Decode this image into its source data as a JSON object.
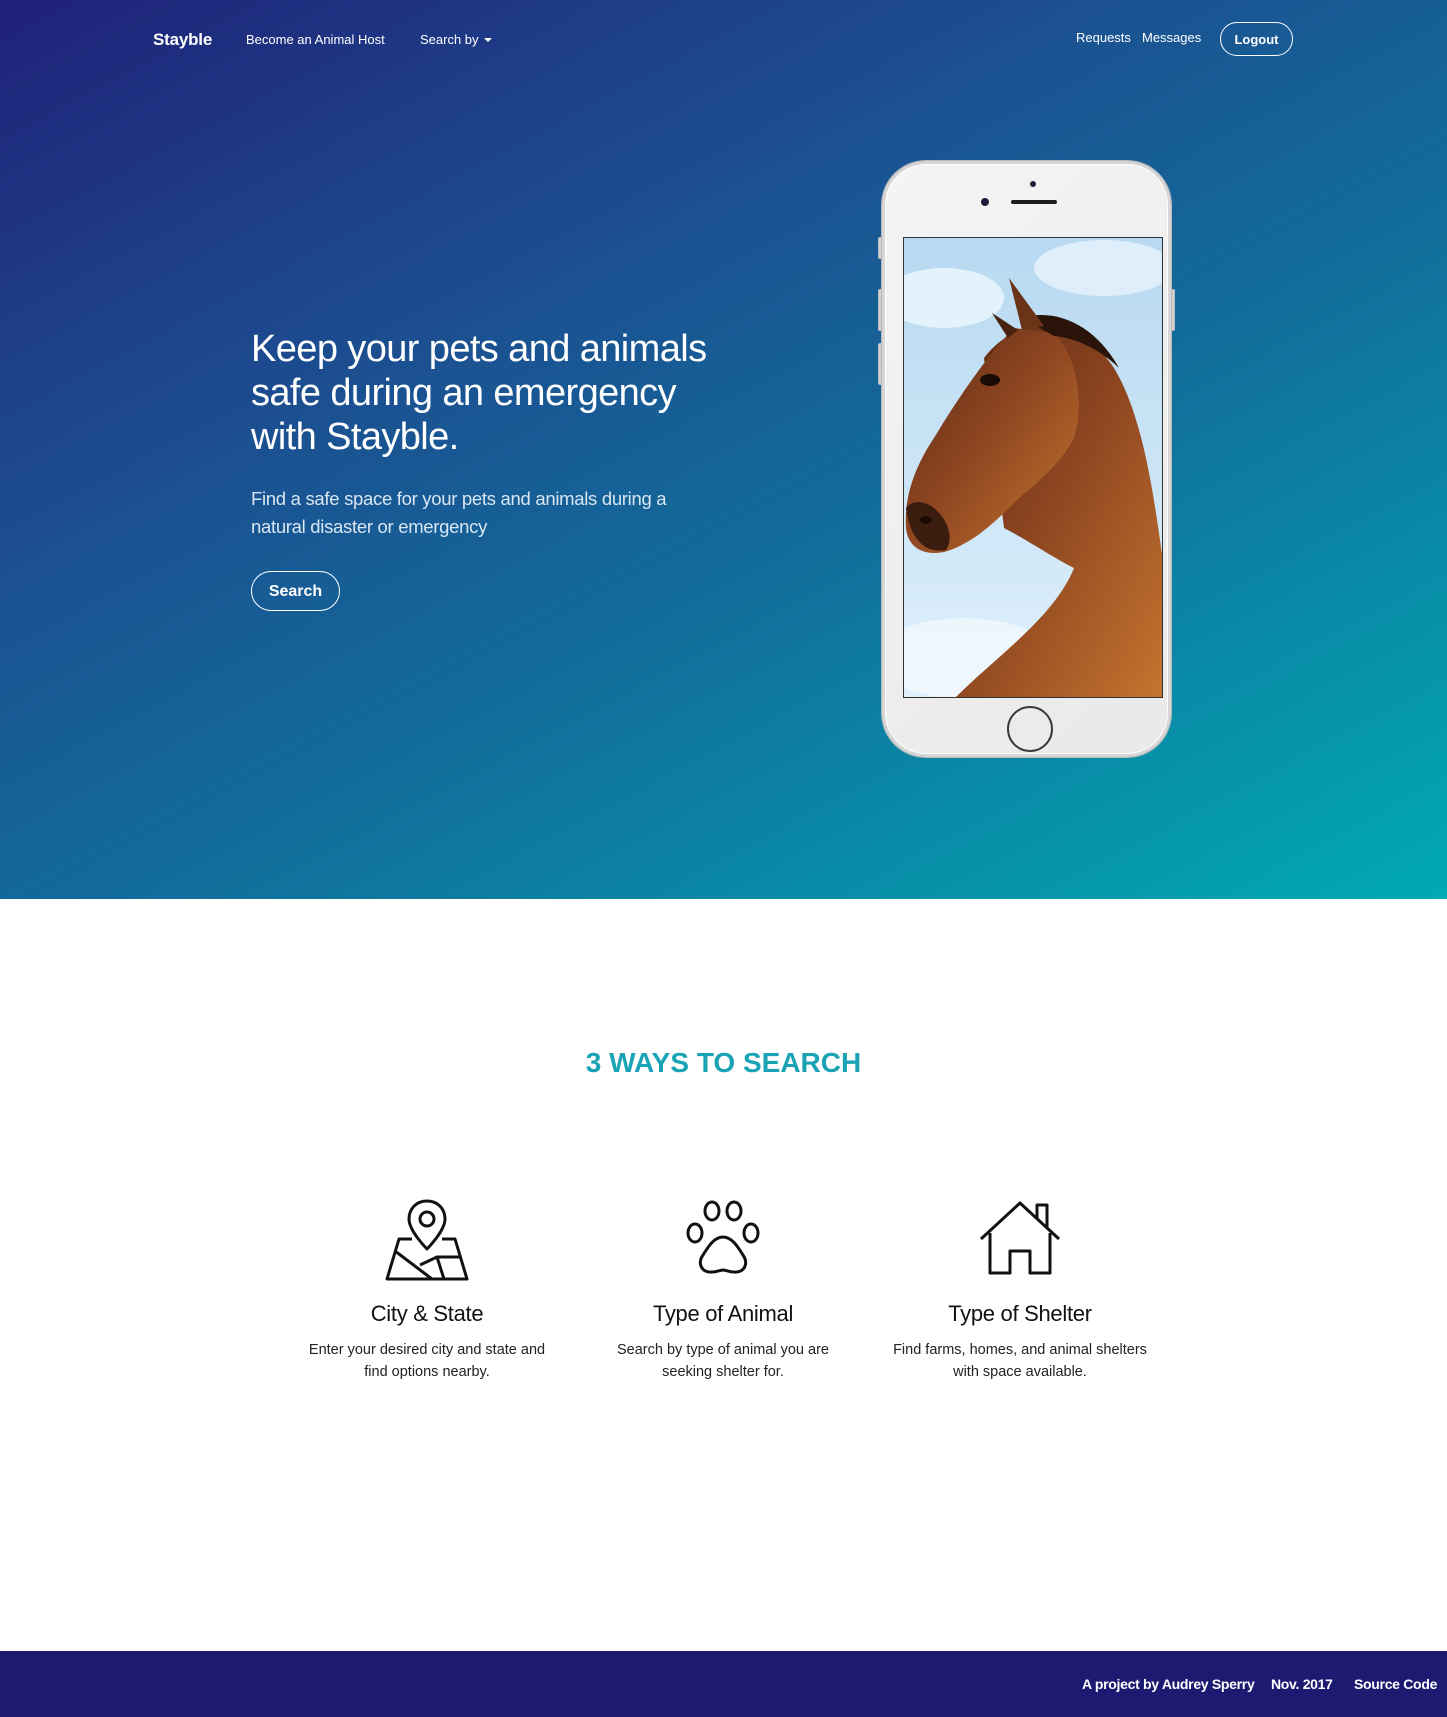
{
  "nav": {
    "brand": "Stayble",
    "become_host": "Become an Animal Host",
    "search_by": "Search by",
    "requests": "Requests",
    "messages": "Messages",
    "logout": "Logout"
  },
  "hero": {
    "title": "Keep your pets and animals safe during an emergency with Stayble.",
    "subtitle": "Find a safe space for your pets and animals during a natural disaster or emergency",
    "search_button": "Search"
  },
  "features": {
    "heading": "3 WAYS TO SEARCH",
    "items": [
      {
        "icon": "map-pin-icon",
        "title": "City & State",
        "description": "Enter your desired city and state and find options nearby."
      },
      {
        "icon": "paw-icon",
        "title": "Type of Animal",
        "description": "Search by type of animal you are seeking shelter for."
      },
      {
        "icon": "house-icon",
        "title": "Type of Shelter",
        "description": "Find farms, homes, and animal shelters with space available."
      }
    ]
  },
  "footer": {
    "author": "A project by Audrey Sperry",
    "date": "Nov. 2017",
    "source": "Source Code"
  },
  "colors": {
    "hero_gradient_start": "#1f2178",
    "hero_gradient_end": "#00aab3",
    "accent": "#1aa3b5",
    "footer_bg": "#1d1a72"
  }
}
